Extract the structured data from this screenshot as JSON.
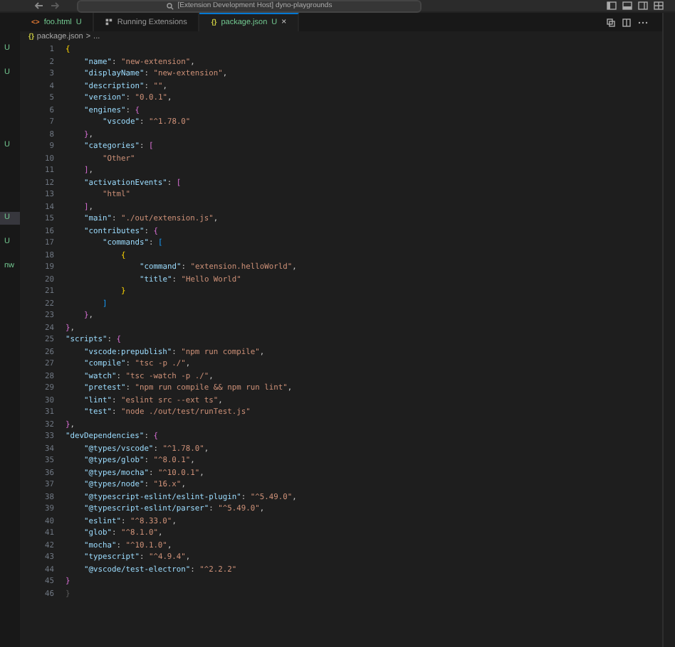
{
  "window": {
    "title": "[Extension Development Host] dyno-playgrounds"
  },
  "sidebar": {
    "items": [
      {
        "kind": "badge",
        "text": "U",
        "selected": false
      },
      {
        "kind": "spacer"
      },
      {
        "kind": "badge",
        "text": "U",
        "selected": false
      },
      {
        "kind": "spacer"
      },
      {
        "kind": "spacer"
      },
      {
        "kind": "spacer"
      },
      {
        "kind": "spacer"
      },
      {
        "kind": "spacer"
      },
      {
        "kind": "badge",
        "text": "U",
        "selected": false
      },
      {
        "kind": "spacer"
      },
      {
        "kind": "spacer"
      },
      {
        "kind": "spacer"
      },
      {
        "kind": "spacer"
      },
      {
        "kind": "spacer"
      },
      {
        "kind": "badge",
        "text": "U",
        "selected": true
      },
      {
        "kind": "spacer"
      },
      {
        "kind": "badge",
        "text": "U",
        "selected": false
      },
      {
        "kind": "spacer"
      },
      {
        "kind": "badge",
        "text": "nw",
        "selected": false
      }
    ]
  },
  "tabs": [
    {
      "kind": "html",
      "icon": "<>",
      "label": "foo.html",
      "status": "U",
      "selected": false
    },
    {
      "kind": "extensions",
      "label": "Running Extensions",
      "selected": false
    },
    {
      "kind": "json",
      "icon": "{}",
      "label": "package.json",
      "status": "U",
      "close": "×",
      "selected": true
    }
  ],
  "breadcrumb": {
    "icon": "{}",
    "file": "package.json",
    "separator": ">",
    "more": "..."
  },
  "editor": {
    "lines": [
      {
        "number": "1",
        "tokens": [
          {
            "kind": "b1",
            "text": "{"
          }
        ]
      },
      {
        "number": "2",
        "tokens": [
          {
            "kind": "k",
            "text": "\"name\""
          },
          {
            "kind": "p",
            "text": ": "
          },
          {
            "kind": "s",
            "text": "\"new-extension\""
          },
          {
            "kind": "p",
            "text": ","
          }
        ]
      },
      {
        "number": "3",
        "tokens": [
          {
            "kind": "k",
            "text": "\"displayName\""
          },
          {
            "kind": "p",
            "text": ": "
          },
          {
            "kind": "s",
            "text": "\"new-extension\""
          },
          {
            "kind": "p",
            "text": ","
          }
        ]
      },
      {
        "number": "4",
        "tokens": [
          {
            "kind": "k",
            "text": "\"description\""
          },
          {
            "kind": "p",
            "text": ": "
          },
          {
            "kind": "s",
            "text": "\"\""
          },
          {
            "kind": "p",
            "text": ","
          }
        ]
      },
      {
        "number": "5",
        "tokens": [
          {
            "kind": "k",
            "text": "\"version\""
          },
          {
            "kind": "p",
            "text": ": "
          },
          {
            "kind": "s",
            "text": "\"0.0.1\""
          },
          {
            "kind": "p",
            "text": ","
          }
        ]
      },
      {
        "number": "6",
        "tokens": [
          {
            "kind": "k",
            "text": "\"engines\""
          },
          {
            "kind": "p",
            "text": ": "
          },
          {
            "kind": "b2",
            "text": "{"
          }
        ]
      },
      {
        "number": "7",
        "tokens": [
          {
            "kind": "k",
            "text": "\"vscode\""
          },
          {
            "kind": "p",
            "text": ": "
          },
          {
            "kind": "s",
            "text": "\"^1.78.0\""
          }
        ]
      },
      {
        "number": "8",
        "tokens": [
          {
            "kind": "b2",
            "text": "}"
          },
          {
            "kind": "p",
            "text": ","
          }
        ]
      },
      {
        "number": "9",
        "tokens": [
          {
            "kind": "k",
            "text": "\"categories\""
          },
          {
            "kind": "p",
            "text": ": "
          },
          {
            "kind": "b2",
            "text": "["
          }
        ]
      },
      {
        "number": "10",
        "tokens": [
          {
            "kind": "s",
            "text": "\"Other\""
          }
        ]
      },
      {
        "number": "11",
        "tokens": [
          {
            "kind": "b2",
            "text": "]"
          },
          {
            "kind": "p",
            "text": ","
          }
        ]
      },
      {
        "number": "12",
        "tokens": [
          {
            "kind": "k",
            "text": "\"activationEvents\""
          },
          {
            "kind": "p",
            "text": ": "
          },
          {
            "kind": "b2",
            "text": "["
          }
        ]
      },
      {
        "number": "13",
        "tokens": [
          {
            "kind": "s",
            "text": "\"html\""
          }
        ]
      },
      {
        "number": "14",
        "tokens": [
          {
            "kind": "b2",
            "text": "]"
          },
          {
            "kind": "p",
            "text": ","
          }
        ]
      },
      {
        "number": "15",
        "tokens": [
          {
            "kind": "k",
            "text": "\"main\""
          },
          {
            "kind": "p",
            "text": ": "
          },
          {
            "kind": "s",
            "text": "\"./out/extension.js\""
          },
          {
            "kind": "p",
            "text": ","
          }
        ]
      },
      {
        "number": "16",
        "tokens": [
          {
            "kind": "k",
            "text": "\"contributes\""
          },
          {
            "kind": "p",
            "text": ": "
          },
          {
            "kind": "b2",
            "text": "{"
          }
        ]
      },
      {
        "number": "17",
        "tokens": [
          {
            "kind": "k",
            "text": "\"commands\""
          },
          {
            "kind": "p",
            "text": ": "
          },
          {
            "kind": "b3",
            "text": "["
          }
        ]
      },
      {
        "number": "18",
        "tokens": [
          {
            "kind": "b1",
            "text": "{"
          }
        ]
      },
      {
        "number": "19",
        "tokens": [
          {
            "kind": "k",
            "text": "\"command\""
          },
          {
            "kind": "p",
            "text": ": "
          },
          {
            "kind": "s",
            "text": "\"extension.helloWorld\""
          },
          {
            "kind": "p",
            "text": ","
          }
        ]
      },
      {
        "number": "20",
        "tokens": [
          {
            "kind": "k",
            "text": "\"title\""
          },
          {
            "kind": "p",
            "text": ": "
          },
          {
            "kind": "s",
            "text": "\"Hello World\""
          }
        ]
      },
      {
        "number": "21",
        "tokens": [
          {
            "kind": "b1",
            "text": "}"
          }
        ]
      },
      {
        "number": "22",
        "tokens": [
          {
            "kind": "b3",
            "text": "]"
          }
        ]
      },
      {
        "number": "23",
        "tokens": [
          {
            "kind": "b2",
            "text": "}"
          },
          {
            "kind": "p",
            "text": ","
          }
        ]
      },
      {
        "number": "24",
        "tokens": [
          {
            "kind": "b2",
            "text": "}"
          },
          {
            "kind": "p",
            "text": ","
          }
        ]
      },
      {
        "number": "25",
        "tokens": [
          {
            "kind": "k",
            "text": "\"scripts\""
          },
          {
            "kind": "p",
            "text": ": "
          },
          {
            "kind": "b2",
            "text": "{"
          }
        ]
      },
      {
        "number": "26",
        "tokens": [
          {
            "kind": "k",
            "text": "\"vscode:prepublish\""
          },
          {
            "kind": "p",
            "text": ": "
          },
          {
            "kind": "s",
            "text": "\"npm run compile\""
          },
          {
            "kind": "p",
            "text": ","
          }
        ]
      },
      {
        "number": "27",
        "tokens": [
          {
            "kind": "k",
            "text": "\"compile\""
          },
          {
            "kind": "p",
            "text": ": "
          },
          {
            "kind": "s",
            "text": "\"tsc -p ./\""
          },
          {
            "kind": "p",
            "text": ","
          }
        ]
      },
      {
        "number": "28",
        "tokens": [
          {
            "kind": "k",
            "text": "\"watch\""
          },
          {
            "kind": "p",
            "text": ": "
          },
          {
            "kind": "s",
            "text": "\"tsc -watch -p ./\""
          },
          {
            "kind": "p",
            "text": ","
          }
        ]
      },
      {
        "number": "29",
        "tokens": [
          {
            "kind": "k",
            "text": "\"pretest\""
          },
          {
            "kind": "p",
            "text": ": "
          },
          {
            "kind": "s",
            "text": "\"npm run compile && npm run lint\""
          },
          {
            "kind": "p",
            "text": ","
          }
        ]
      },
      {
        "number": "30",
        "tokens": [
          {
            "kind": "k",
            "text": "\"lint\""
          },
          {
            "kind": "p",
            "text": ": "
          },
          {
            "kind": "s",
            "text": "\"eslint src --ext ts\""
          },
          {
            "kind": "p",
            "text": ","
          }
        ]
      },
      {
        "number": "31",
        "tokens": [
          {
            "kind": "k",
            "text": "\"test\""
          },
          {
            "kind": "p",
            "text": ": "
          },
          {
            "kind": "s",
            "text": "\"node ./out/test/runTest.js\""
          }
        ]
      },
      {
        "number": "32",
        "tokens": [
          {
            "kind": "b2",
            "text": "}"
          },
          {
            "kind": "p",
            "text": ","
          }
        ]
      },
      {
        "number": "33",
        "tokens": [
          {
            "kind": "k",
            "text": "\"devDependencies\""
          },
          {
            "kind": "p",
            "text": ": "
          },
          {
            "kind": "b2",
            "text": "{"
          }
        ]
      },
      {
        "number": "34",
        "tokens": [
          {
            "kind": "k",
            "text": "\"@types/vscode\""
          },
          {
            "kind": "p",
            "text": ": "
          },
          {
            "kind": "s",
            "text": "\"^1.78.0\""
          },
          {
            "kind": "p",
            "text": ","
          }
        ]
      },
      {
        "number": "35",
        "tokens": [
          {
            "kind": "k",
            "text": "\"@types/glob\""
          },
          {
            "kind": "p",
            "text": ": "
          },
          {
            "kind": "s",
            "text": "\"^8.0.1\""
          },
          {
            "kind": "p",
            "text": ","
          }
        ]
      },
      {
        "number": "36",
        "tokens": [
          {
            "kind": "k",
            "text": "\"@types/mocha\""
          },
          {
            "kind": "p",
            "text": ": "
          },
          {
            "kind": "s",
            "text": "\"^10.0.1\""
          },
          {
            "kind": "p",
            "text": ","
          }
        ]
      },
      {
        "number": "37",
        "tokens": [
          {
            "kind": "k",
            "text": "\"@types/node\""
          },
          {
            "kind": "p",
            "text": ": "
          },
          {
            "kind": "s",
            "text": "\"16.x\""
          },
          {
            "kind": "p",
            "text": ","
          }
        ]
      },
      {
        "number": "38",
        "tokens": [
          {
            "kind": "k",
            "text": "\"@typescript-eslint/eslint-plugin\""
          },
          {
            "kind": "p",
            "text": ": "
          },
          {
            "kind": "s",
            "text": "\"^5.49.0\""
          },
          {
            "kind": "p",
            "text": ","
          }
        ]
      },
      {
        "number": "39",
        "tokens": [
          {
            "kind": "k",
            "text": "\"@typescript-eslint/parser\""
          },
          {
            "kind": "p",
            "text": ": "
          },
          {
            "kind": "s",
            "text": "\"^5.49.0\""
          },
          {
            "kind": "p",
            "text": ","
          }
        ]
      },
      {
        "number": "40",
        "tokens": [
          {
            "kind": "k",
            "text": "\"eslint\""
          },
          {
            "kind": "p",
            "text": ": "
          },
          {
            "kind": "s",
            "text": "\"^8.33.0\""
          },
          {
            "kind": "p",
            "text": ","
          }
        ]
      },
      {
        "number": "41",
        "tokens": [
          {
            "kind": "k",
            "text": "\"glob\""
          },
          {
            "kind": "p",
            "text": ": "
          },
          {
            "kind": "s",
            "text": "\"^8.1.0\""
          },
          {
            "kind": "p",
            "text": ","
          }
        ]
      },
      {
        "number": "42",
        "tokens": [
          {
            "kind": "k",
            "text": "\"mocha\""
          },
          {
            "kind": "p",
            "text": ": "
          },
          {
            "kind": "s",
            "text": "\"^10.1.0\""
          },
          {
            "kind": "p",
            "text": ","
          }
        ]
      },
      {
        "number": "43",
        "tokens": [
          {
            "kind": "k",
            "text": "\"typescript\""
          },
          {
            "kind": "p",
            "text": ": "
          },
          {
            "kind": "s",
            "text": "\"^4.9.4\""
          },
          {
            "kind": "p",
            "text": ","
          }
        ]
      },
      {
        "number": "44",
        "tokens": [
          {
            "kind": "k",
            "text": "\"@vscode/test-electron\""
          },
          {
            "kind": "p",
            "text": ": "
          },
          {
            "kind": "s",
            "text": "\"^2.2.2\""
          }
        ]
      },
      {
        "number": "45",
        "tokens": [
          {
            "kind": "b2",
            "text": "}"
          }
        ]
      },
      {
        "number": "46",
        "tokens": [
          {
            "kind": "ghost",
            "text": "}"
          }
        ]
      }
    ]
  }
}
